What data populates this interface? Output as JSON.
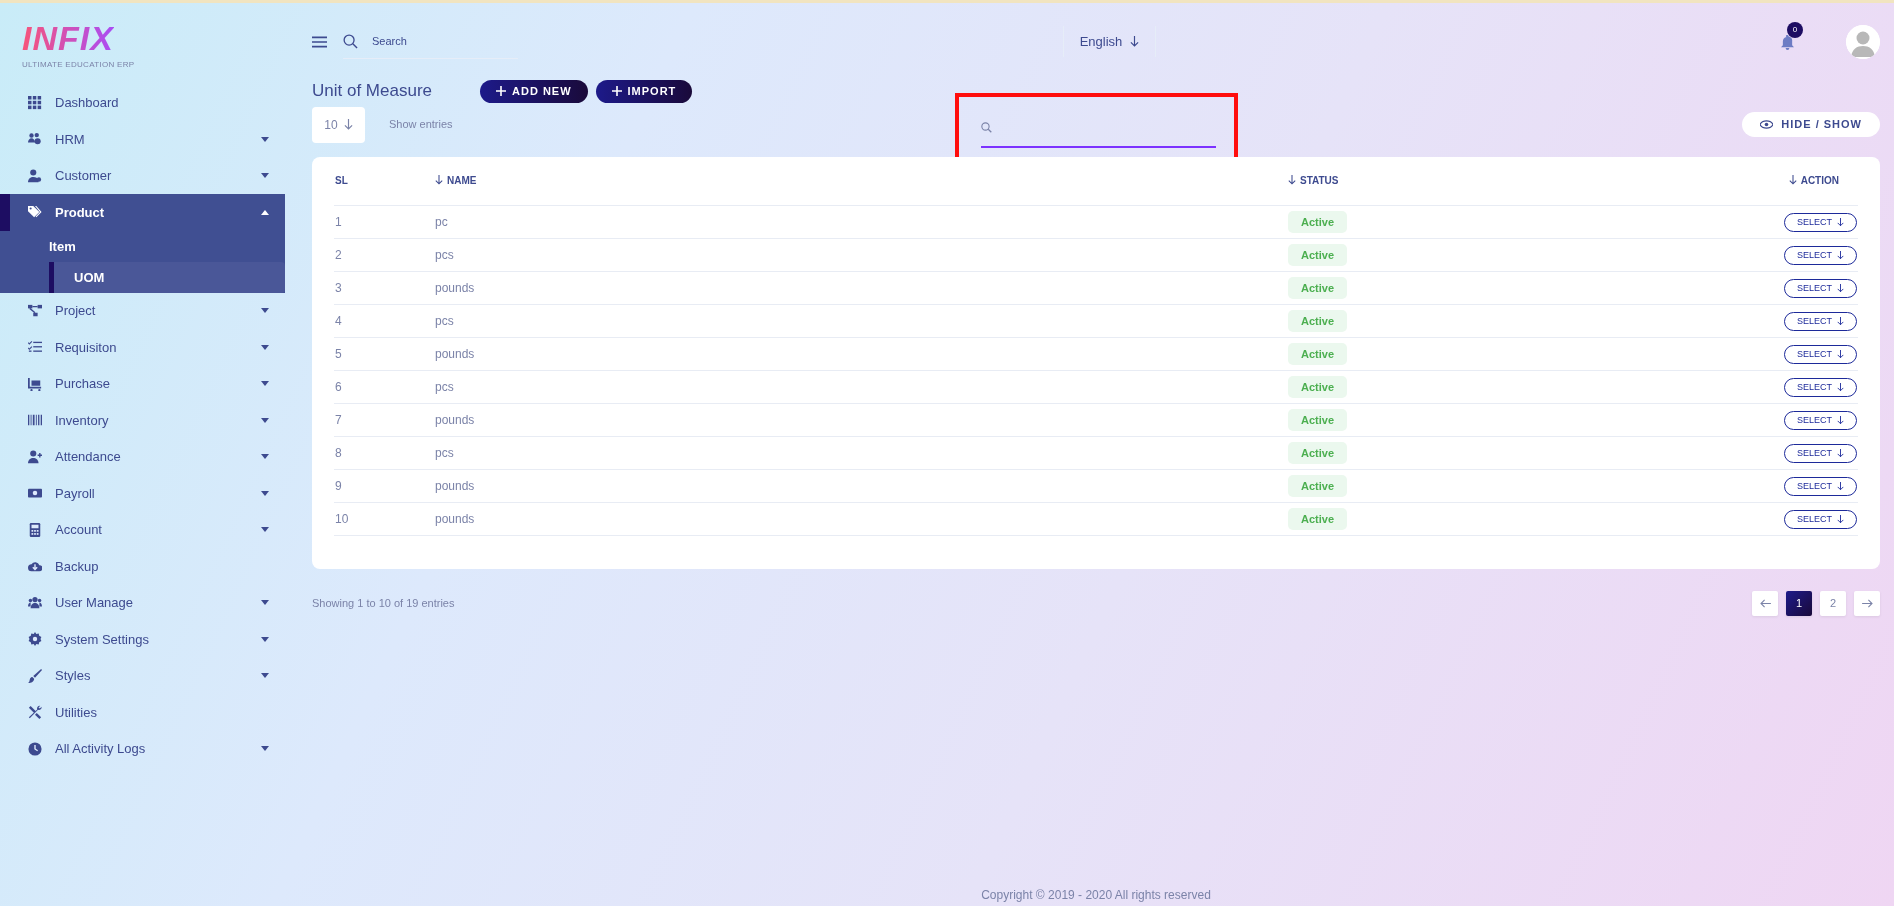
{
  "logo": {
    "wordmark": "INFIX",
    "tagline": "ULTIMATE EDUCATION ERP"
  },
  "sidebar": {
    "items": [
      {
        "label": "Dashboard",
        "expandable": false,
        "expanded": false,
        "selected": false
      },
      {
        "label": "HRM",
        "expandable": true,
        "expanded": false,
        "selected": false
      },
      {
        "label": "Customer",
        "expandable": true,
        "expanded": false,
        "selected": false
      },
      {
        "label": "Product",
        "expandable": true,
        "expanded": true,
        "selected": true,
        "children": [
          {
            "label": "Item",
            "selected": false
          },
          {
            "label": "UOM",
            "selected": true
          }
        ]
      },
      {
        "label": "Project",
        "expandable": true,
        "expanded": false,
        "selected": false
      },
      {
        "label": "Requisiton",
        "expandable": true,
        "expanded": false,
        "selected": false
      },
      {
        "label": "Purchase",
        "expandable": true,
        "expanded": false,
        "selected": false
      },
      {
        "label": "Inventory",
        "expandable": true,
        "expanded": false,
        "selected": false
      },
      {
        "label": "Attendance",
        "expandable": true,
        "expanded": false,
        "selected": false
      },
      {
        "label": "Payroll",
        "expandable": true,
        "expanded": false,
        "selected": false
      },
      {
        "label": "Account",
        "expandable": true,
        "expanded": false,
        "selected": false
      },
      {
        "label": "Backup",
        "expandable": false,
        "expanded": false,
        "selected": false
      },
      {
        "label": "User Manage",
        "expandable": true,
        "expanded": false,
        "selected": false
      },
      {
        "label": "System Settings",
        "expandable": true,
        "expanded": false,
        "selected": false
      },
      {
        "label": "Styles",
        "expandable": true,
        "expanded": false,
        "selected": false
      },
      {
        "label": "Utilities",
        "expandable": false,
        "expanded": false,
        "selected": false
      },
      {
        "label": "All Activity Logs",
        "expandable": true,
        "expanded": false,
        "selected": false
      }
    ]
  },
  "header": {
    "search": {
      "placeholder": "Search"
    },
    "language": "English",
    "notifications": "0"
  },
  "page": {
    "title": "Unit of Measure",
    "buttons": [
      "ADD NEW",
      "IMPORT"
    ],
    "page_size": "10",
    "page_size_label": "Show entries",
    "table_search": {
      "highlighted": true
    },
    "hide_show": "HIDE / SHOW"
  },
  "table": {
    "columns": [
      {
        "label": "SL",
        "sortable": false
      },
      {
        "label": "NAME",
        "sortable": true
      },
      {
        "label": "STATUS",
        "sortable": true
      },
      {
        "label": "ACTION",
        "sortable": true
      }
    ],
    "rows": [
      {
        "sl": "1",
        "name": "pc",
        "status": "Active",
        "action": "SELECT"
      },
      {
        "sl": "2",
        "name": "pcs",
        "status": "Active",
        "action": "SELECT"
      },
      {
        "sl": "3",
        "name": "pounds",
        "status": "Active",
        "action": "SELECT"
      },
      {
        "sl": "4",
        "name": "pcs",
        "status": "Active",
        "action": "SELECT"
      },
      {
        "sl": "5",
        "name": "pounds",
        "status": "Active",
        "action": "SELECT"
      },
      {
        "sl": "6",
        "name": "pcs",
        "status": "Active",
        "action": "SELECT"
      },
      {
        "sl": "7",
        "name": "pounds",
        "status": "Active",
        "action": "SELECT"
      },
      {
        "sl": "8",
        "name": "pcs",
        "status": "Active",
        "action": "SELECT"
      },
      {
        "sl": "9",
        "name": "pounds",
        "status": "Active",
        "action": "SELECT"
      },
      {
        "sl": "10",
        "name": "pounds",
        "status": "Active",
        "action": "SELECT"
      }
    ]
  },
  "summary": "Showing 1 to 10 of 19 entries",
  "pagination": {
    "pages": [
      {
        "label": "1",
        "selected": true
      },
      {
        "label": "2",
        "selected": false
      }
    ]
  },
  "footer": "Copyright © 2019 - 2020 All rights reserved"
}
